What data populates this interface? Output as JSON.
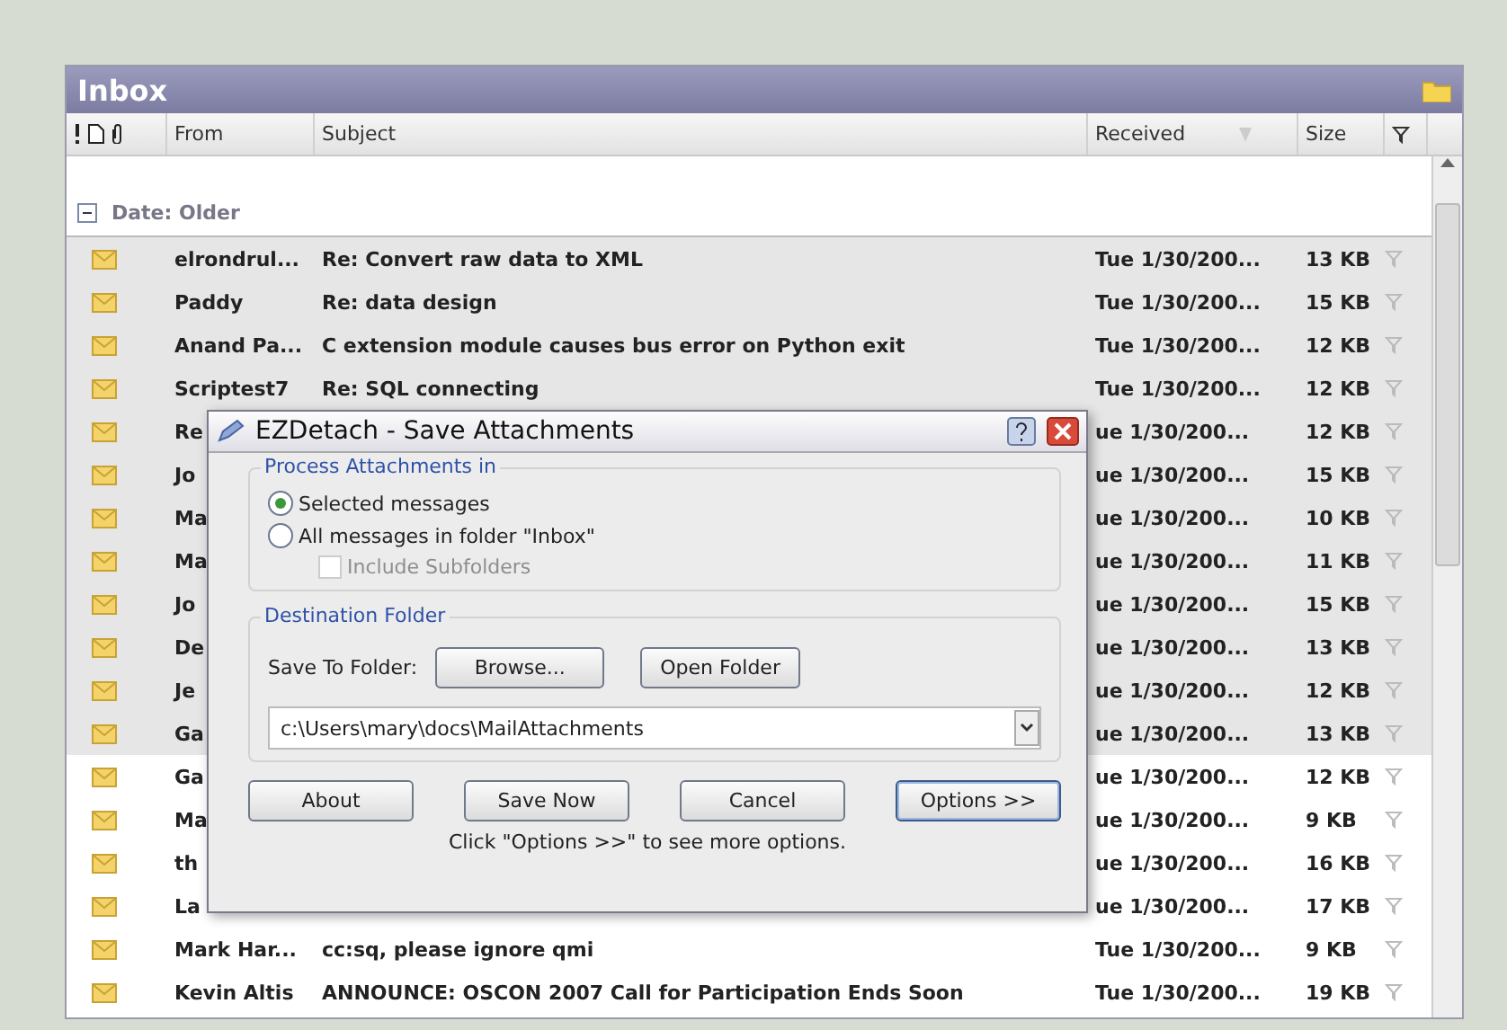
{
  "pane": {
    "title": "Inbox"
  },
  "columns": {
    "from": "From",
    "subject": "Subject",
    "received": "Received",
    "size": "Size"
  },
  "group": {
    "label": "Date: Older",
    "expanded": true
  },
  "rows": [
    {
      "from": "elrondrul...",
      "subject": "Re: Convert raw data to XML",
      "received": "Tue 1/30/200...",
      "size": "13 KB",
      "selected": true
    },
    {
      "from": "Paddy",
      "subject": "Re: data design",
      "received": "Tue 1/30/200...",
      "size": "15 KB",
      "selected": true
    },
    {
      "from": "Anand Pa...",
      "subject": "C extension module causes bus error on Python exit",
      "received": "Tue 1/30/200...",
      "size": "12 KB",
      "selected": true
    },
    {
      "from": "Scriptest7",
      "subject": "Re: SQL connecting",
      "received": "Tue 1/30/200...",
      "size": "12 KB",
      "selected": true
    },
    {
      "from": "Re",
      "received": "ue 1/30/200...",
      "size": "12 KB",
      "selected": true
    },
    {
      "from": "Jo",
      "received": "ue 1/30/200...",
      "size": "15 KB",
      "selected": true
    },
    {
      "from": "Ma",
      "received": "ue 1/30/200...",
      "size": "10 KB",
      "selected": true
    },
    {
      "from": "Ma",
      "received": "ue 1/30/200...",
      "size": "11 KB",
      "selected": true
    },
    {
      "from": "Jo",
      "received": "ue 1/30/200...",
      "size": "15 KB",
      "selected": true
    },
    {
      "from": "De",
      "received": "ue 1/30/200...",
      "size": "13 KB",
      "selected": true
    },
    {
      "from": "Je",
      "received": "ue 1/30/200...",
      "size": "12 KB",
      "selected": true
    },
    {
      "from": "Ga",
      "received": "ue 1/30/200...",
      "size": "13 KB",
      "selected": true
    },
    {
      "from": "Ga",
      "received": "ue 1/30/200...",
      "size": "12 KB",
      "selected": false
    },
    {
      "from": "Ma",
      "received": "ue 1/30/200...",
      "size": "9 KB",
      "selected": false
    },
    {
      "from": "th",
      "received": "ue 1/30/200...",
      "size": "16 KB",
      "selected": false
    },
    {
      "from": "La",
      "received": "ue 1/30/200...",
      "size": "17 KB",
      "selected": false
    },
    {
      "from": "Mark Har...",
      "subject": "cc:sq, please ignore qmi",
      "received": "Tue 1/30/200...",
      "size": "9 KB",
      "selected": false
    },
    {
      "from": "Kevin Altis",
      "subject": "ANNOUNCE: OSCON 2007 Call for Participation Ends Soon",
      "received": "Tue 1/30/200...",
      "size": "19 KB",
      "selected": false
    }
  ],
  "dialog": {
    "title": "EZDetach - Save Attachments",
    "process_group": {
      "label": "Process Attachments in",
      "options": [
        {
          "label": "Selected messages",
          "selected": true
        },
        {
          "label": "All messages in folder \"Inbox\"",
          "selected": false
        }
      ],
      "include_subfolders": {
        "label": "Include Subfolders",
        "checked": false,
        "disabled": true
      }
    },
    "destination_group": {
      "label": "Destination Folder",
      "save_to_label": "Save To Folder:",
      "browse": "Browse...",
      "open_folder": "Open Folder",
      "path": "c:\\Users\\mary\\docs\\MailAttachments"
    },
    "buttons": [
      {
        "label": "About",
        "default": false
      },
      {
        "label": "Save Now",
        "default": false
      },
      {
        "label": "Cancel",
        "default": false
      },
      {
        "label": "Options >>",
        "default": true
      }
    ],
    "hint": "Click \"Options >>\" to see more options."
  }
}
